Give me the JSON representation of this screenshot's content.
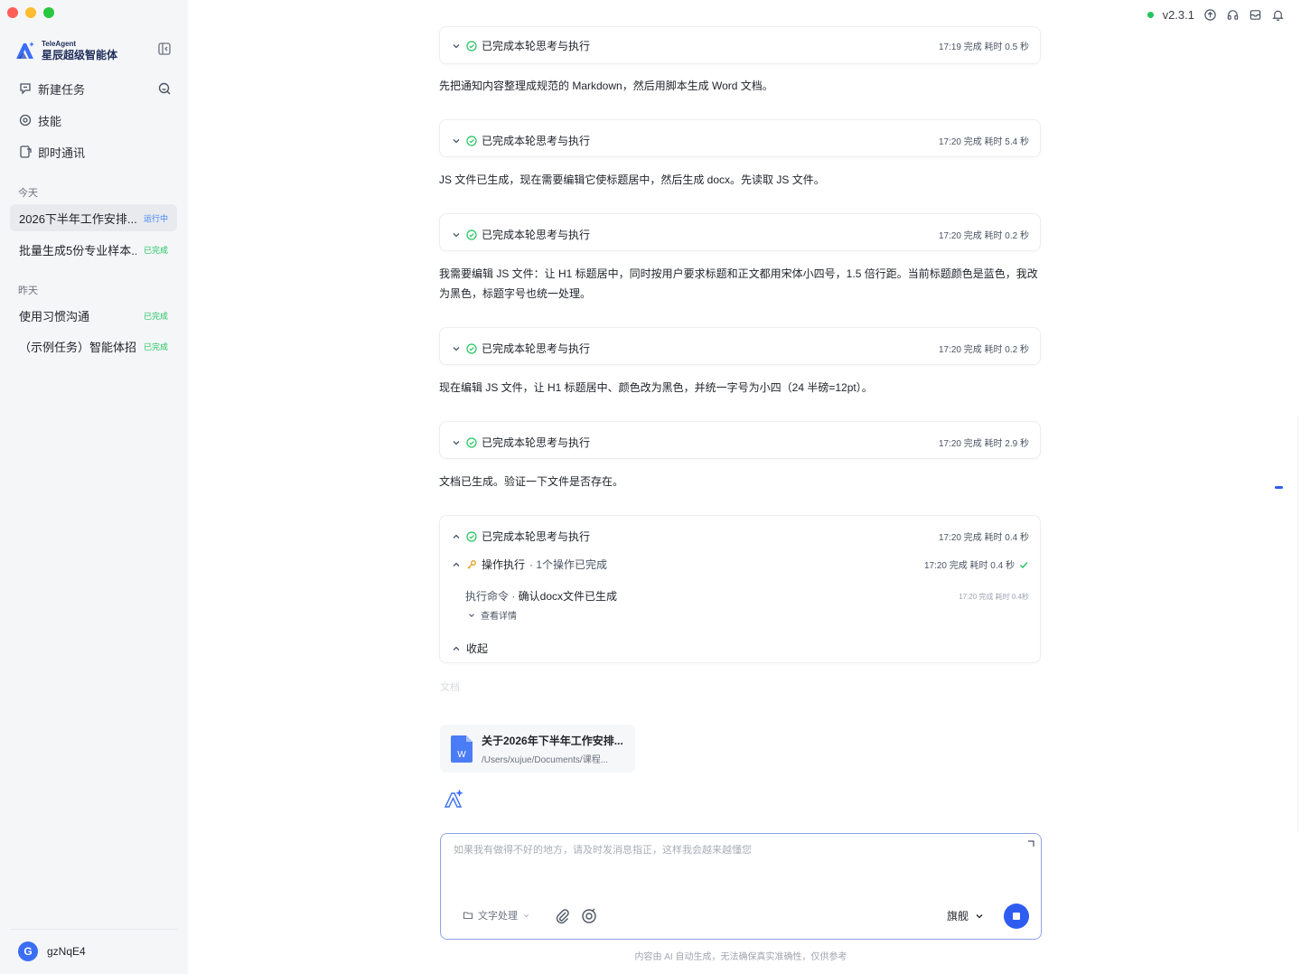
{
  "window": {
    "controls": {
      "close": "#ff5f57",
      "minimize": "#febc2e",
      "maximize": "#28c840"
    }
  },
  "brand": {
    "small": "TeleAgent",
    "name": "星辰超级智能体",
    "color": "#3b6ef6"
  },
  "sidebar": {
    "new_task": "新建任务",
    "skills": "技能",
    "im": "即时通讯",
    "today_label": "今天",
    "yesterday_label": "昨天",
    "today_tasks": [
      {
        "title": "2026下半年工作安排...",
        "status": "运行中",
        "status_color": "#3b82f6"
      },
      {
        "title": "批量生成5份专业样本...",
        "status": "已完成",
        "status_color": "#22c55e"
      }
    ],
    "yesterday_tasks": [
      {
        "title": "使用习惯沟通",
        "status": "已完成",
        "status_color": "#22c55e"
      },
      {
        "title": "（示例任务）智能体招...",
        "status": "已完成",
        "status_color": "#22c55e"
      }
    ],
    "user": {
      "initial": "G",
      "name": "gzNqE4"
    }
  },
  "topbar": {
    "version": "v2.3.1"
  },
  "steps": [
    {
      "label": "已完成本轮思考与执行",
      "meta": "17:19 完成 耗时 0.5 秒"
    },
    {
      "label": "已完成本轮思考与执行",
      "meta": "17:20 完成 耗时 5.4 秒"
    },
    {
      "label": "已完成本轮思考与执行",
      "meta": "17:20 完成 耗时 0.2 秒"
    },
    {
      "label": "已完成本轮思考与执行",
      "meta": "17:20 完成 耗时 0.2 秒"
    },
    {
      "label": "已完成本轮思考与执行",
      "meta": "17:20 完成 耗时 2.9 秒"
    },
    {
      "label": "已完成本轮思考与执行",
      "meta": "17:20 完成 耗时 0.4 秒"
    }
  ],
  "messages": [
    "先把通知内容整理成规范的 Markdown，然后用脚本生成 Word 文档。",
    "JS 文件已生成，现在需要编辑它使标题居中，然后生成 docx。先读取 JS 文件。",
    "我需要编辑 JS 文件：让 H1 标题居中，同时按用户要求标题和正文都用宋体小四号，1.5 倍行距。当前标题颜色是蓝色，我改为黑色，标题字号也统一处理。",
    "现在编辑 JS 文件，让 H1 标题居中、颜色改为黑色，并统一字号为小四（24 半磅=12pt）。",
    "文档已生成。验证一下文件是否存在。"
  ],
  "expanded": {
    "op_title": "操作执行",
    "op_summary": "· 1个操作已完成",
    "op_meta": "17:20 完成 耗时 0.4 秒",
    "cmd_prefix": "执行命令 · ",
    "cmd_name": "确认docx文件已生成",
    "cmd_meta": "17:20  完成   耗时 0.4秒",
    "details": "查看详情",
    "collapse": "收起"
  },
  "doc_section_label": "文档",
  "file": {
    "name": "关于2026年下半年工作安排...",
    "path": "/Users/xujue/Documents/课程..."
  },
  "composer": {
    "placeholder": "如果我有做得不好的地方，请及时发消息指正，这样我会越来越懂您",
    "tool": "文字处理",
    "model": "旗舰"
  },
  "disclaimer": "内容由 AI 自动生成，无法确保真实准确性，仅供参考"
}
